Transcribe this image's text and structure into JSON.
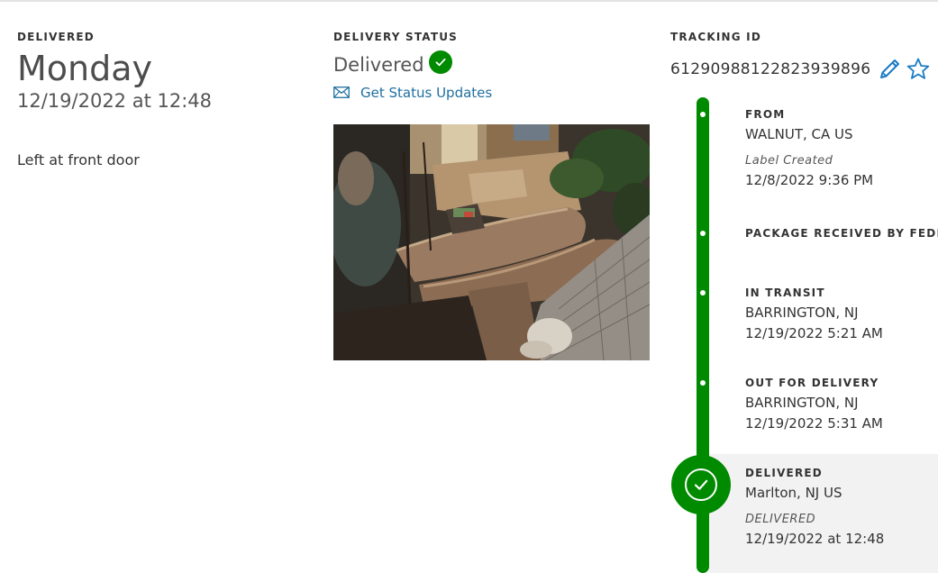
{
  "delivered_col": {
    "eyebrow": "DELIVERED",
    "day": "Monday",
    "datetime": "12/19/2022 at 12:48",
    "note": "Left at front door"
  },
  "status_col": {
    "eyebrow": "DELIVERY STATUS",
    "status": "Delivered",
    "updates_link": "Get Status Updates",
    "photo_description": "delivery-photo"
  },
  "tracking_col": {
    "eyebrow": "TRACKING ID",
    "tracking_id": "61290988122823939896",
    "edit_icon": "pencil-icon",
    "favorite_icon": "star-icon"
  },
  "timeline": {
    "from": {
      "head": "FROM",
      "loc": "WALNUT, CA US",
      "sub": "Label Created",
      "time": "12/8/2022 9:36 PM"
    },
    "received": {
      "head": "PACKAGE RECEIVED BY FEDEX"
    },
    "transit": {
      "head": "IN TRANSIT",
      "loc": "BARRINGTON, NJ",
      "time": "12/19/2022 5:21 AM"
    },
    "out": {
      "head": "OUT FOR DELIVERY",
      "loc": "BARRINGTON, NJ",
      "time": "12/19/2022 5:31 AM"
    },
    "delivered": {
      "head": "DELIVERED",
      "loc": "Marlton, NJ US",
      "sub": "DELIVERED",
      "time": "12/19/2022 at 12:48"
    }
  },
  "colors": {
    "accent_green": "#008a00",
    "link_blue": "#1f6f9e",
    "icon_blue": "#1a7bc4"
  }
}
